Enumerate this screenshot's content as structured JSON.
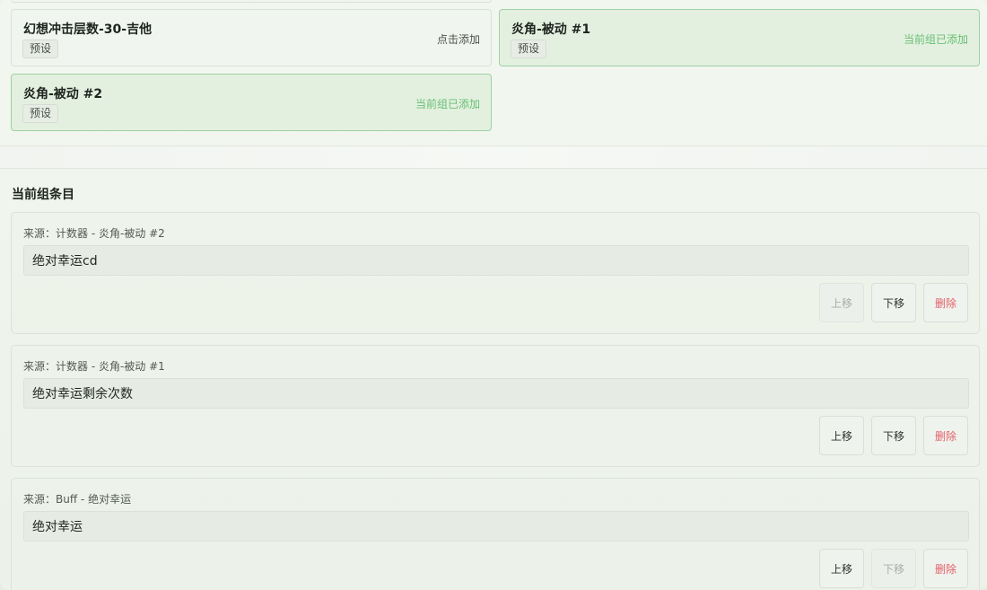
{
  "presets": [
    {
      "name": "幻想冲击层数-30-吉他",
      "tag": "预设",
      "status": "点击添加",
      "added": false
    },
    {
      "name": "炎角-被动 #1",
      "tag": "预设",
      "status": "当前组已添加",
      "added": true
    },
    {
      "name": "炎角-被动 #2",
      "tag": "预设",
      "status": "当前组已添加",
      "added": true
    }
  ],
  "current_group": {
    "title": "当前组条目",
    "entries": [
      {
        "source": "来源：计数器 - 炎角-被动 #2",
        "value": "绝对幸运cd",
        "up_label": "上移",
        "down_label": "下移",
        "delete_label": "删除",
        "up_enabled": false,
        "down_enabled": true
      },
      {
        "source": "来源：计数器 - 炎角-被动 #1",
        "value": "绝对幸运剩余次数",
        "up_label": "上移",
        "down_label": "下移",
        "delete_label": "删除",
        "up_enabled": true,
        "down_enabled": true
      },
      {
        "source": "来源：Buff - 绝对幸运",
        "value": "绝对幸运",
        "up_label": "上移",
        "down_label": "下移",
        "delete_label": "删除",
        "up_enabled": true,
        "down_enabled": false
      }
    ]
  },
  "colors": {
    "added_border": "#9fd1a2",
    "added_text": "#6abf74",
    "delete_text": "#e4606a"
  }
}
